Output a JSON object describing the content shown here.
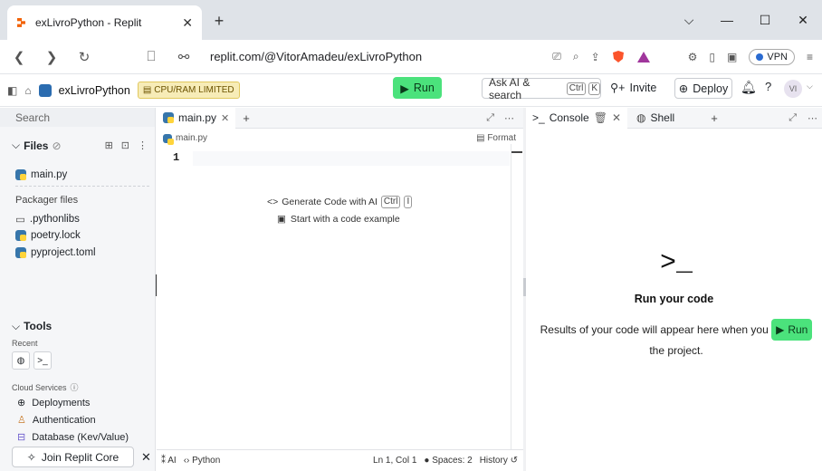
{
  "browser": {
    "tab_title": "exLivroPython - Replit",
    "url": "replit.com/@VitorAmadeu/exLivroPython",
    "vpn_label": "VPN"
  },
  "header": {
    "project_name": "exLivroPython",
    "cpu_badge": "CPU/RAM LIMITED",
    "run_label": "Run",
    "ask_ai": "Ask AI & search",
    "ask_kbd1": "Ctrl",
    "ask_kbd2": "K",
    "invite": "Invite",
    "deploy": "Deploy",
    "avatar": "VI",
    "colors": {
      "run": "#4be27c",
      "cpu_badge": "#f7ecb7"
    }
  },
  "sidebar": {
    "search_placeholder": "Search",
    "files_label": "Files",
    "files": [
      "main.py"
    ],
    "packager_label": "Packager files",
    "packager_files": [
      ".pythonlibs",
      "poetry.lock",
      "pyproject.toml"
    ],
    "tools_label": "Tools",
    "recent_label": "Recent",
    "cloud_label": "Cloud Services",
    "cloud_items": [
      "Deployments",
      "Authentication",
      "Database (Kev/Value)"
    ],
    "join_core": "Join Replit Core"
  },
  "editor": {
    "tab_label": "main.py",
    "breadcrumb": "main.py",
    "format_label": "Format",
    "line_number": "1",
    "generate_code": "Generate Code with AI",
    "gen_kbd1": "Ctrl",
    "gen_kbd2": "I",
    "start_example": "Start with a code example",
    "footer": {
      "ai": "AI",
      "language": "Python",
      "position": "Ln 1, Col 1",
      "spaces": "Spaces: 2",
      "history": "History"
    }
  },
  "console": {
    "tab_console": "Console",
    "tab_shell": "Shell",
    "prompt_glyph": ">_",
    "heading": "Run your code",
    "results_prefix": "Results of your code will appear here when you",
    "run_label": "Run",
    "results_suffix": "the project."
  }
}
